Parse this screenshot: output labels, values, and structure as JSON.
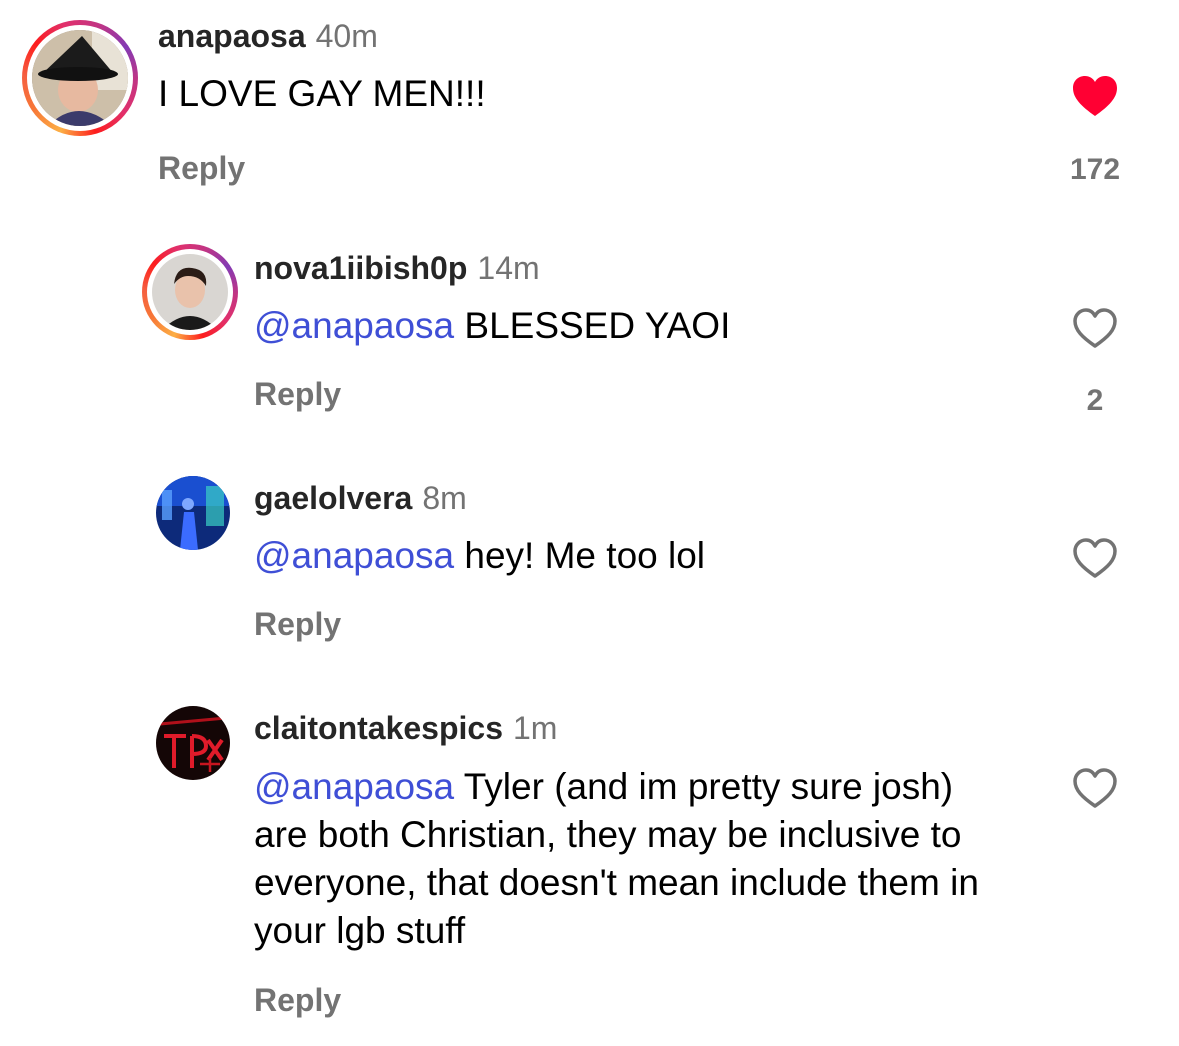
{
  "comments": [
    {
      "username": "anapaosa",
      "time": "40m",
      "text": "I LOVE GAY MEN!!!",
      "reply_label": "Reply",
      "liked": true,
      "like_count": "172",
      "avatar_icon": "user-avatar-witch-hat"
    },
    {
      "username": "nova1iibish0p",
      "time": "14m",
      "mention": "@anapaosa",
      "text": "BLESSED YAOI",
      "reply_label": "Reply",
      "liked": false,
      "like_count": "2",
      "avatar_icon": "user-avatar-portrait"
    },
    {
      "username": "gaelolvera",
      "time": "8m",
      "mention": "@anapaosa",
      "text": "hey! Me too lol",
      "reply_label": "Reply",
      "liked": false,
      "avatar_icon": "user-avatar-blue-neon"
    },
    {
      "username": "claitontakespics",
      "time": "1m",
      "mention": "@anapaosa",
      "text": "Tyler (and im pretty sure josh) are both Christian, they may be inclusive to everyone, that doesn't mean include them in your lgb stuff",
      "reply_label": "Reply",
      "liked": false,
      "avatar_icon": "user-avatar-red-sign"
    }
  ],
  "colors": {
    "mention": "#3f4fd6",
    "liked_heart": "#ff0033",
    "muted": "#737373",
    "story_ring": [
      "#fcaf45",
      "#fd1d1d",
      "#c13584",
      "#833ab4"
    ]
  }
}
